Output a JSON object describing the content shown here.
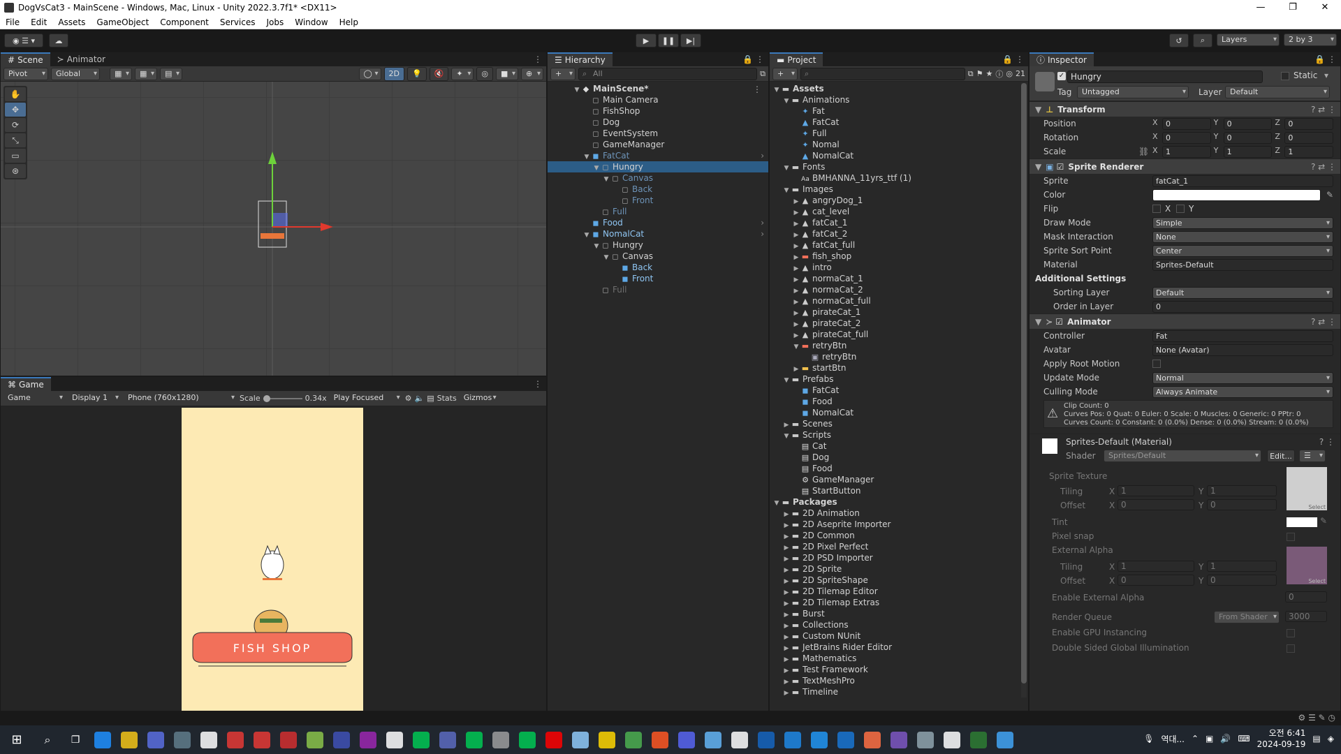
{
  "window": {
    "title": "DogVsCat3 - MainScene - Windows, Mac, Linux - Unity 2022.3.7f1* <DX11>",
    "minimize": "—",
    "maximize": "❐",
    "close": "✕"
  },
  "menu": [
    "File",
    "Edit",
    "Assets",
    "GameObject",
    "Component",
    "Services",
    "Jobs",
    "Window",
    "Help"
  ],
  "toolbar": {
    "layers_label": "Layers",
    "layout_label": "2 by 3"
  },
  "scene": {
    "tabs": [
      "Scene",
      "Animator"
    ],
    "pivot": "Pivot",
    "global": "Global",
    "mode_2d": "2D"
  },
  "game": {
    "tab": "Game",
    "mode": "Game",
    "display": "Display 1",
    "resolution": "Phone (760x1280)",
    "scale_label": "Scale",
    "scale_value": "0.34x",
    "play_focused": "Play Focused",
    "stats": "Stats",
    "gizmos": "Gizmos",
    "sign_text": "FISH  SHOP"
  },
  "hierarchy": {
    "tab": "Hierarchy",
    "search_placeholder": "All",
    "items": [
      {
        "label": "MainScene*",
        "depth": 0,
        "style": "scene"
      },
      {
        "label": "Main Camera",
        "depth": 1,
        "style": ""
      },
      {
        "label": "FishShop",
        "depth": 1,
        "style": ""
      },
      {
        "label": "Dog",
        "depth": 1,
        "style": ""
      },
      {
        "label": "EventSystem",
        "depth": 1,
        "style": ""
      },
      {
        "label": "GameManager",
        "depth": 1,
        "style": ""
      },
      {
        "label": "FatCat",
        "depth": 1,
        "style": "dim-prefab"
      },
      {
        "label": "Hungry",
        "depth": 2,
        "style": "selected"
      },
      {
        "label": "Canvas",
        "depth": 3,
        "style": "dim"
      },
      {
        "label": "Back",
        "depth": 4,
        "style": "dim"
      },
      {
        "label": "Front",
        "depth": 4,
        "style": "dim"
      },
      {
        "label": "Full",
        "depth": 2,
        "style": "dim"
      },
      {
        "label": "Food",
        "depth": 1,
        "style": "prefab"
      },
      {
        "label": "NomalCat",
        "depth": 1,
        "style": "prefab"
      },
      {
        "label": "Hungry",
        "depth": 2,
        "style": ""
      },
      {
        "label": "Canvas",
        "depth": 3,
        "style": ""
      },
      {
        "label": "Back",
        "depth": 4,
        "style": "prefab"
      },
      {
        "label": "Front",
        "depth": 4,
        "style": "prefab"
      },
      {
        "label": "Full",
        "depth": 2,
        "style": "dim2"
      }
    ]
  },
  "project": {
    "tab": "Project",
    "hidden_count": "21",
    "items": [
      {
        "label": "Assets",
        "depth": 0,
        "kind": "folder-open"
      },
      {
        "label": "Animations",
        "depth": 1,
        "kind": "folder-open"
      },
      {
        "label": "Fat",
        "depth": 2,
        "kind": "anim"
      },
      {
        "label": "FatCat",
        "depth": 2,
        "kind": "controller"
      },
      {
        "label": "Full",
        "depth": 2,
        "kind": "anim"
      },
      {
        "label": "Nomal",
        "depth": 2,
        "kind": "anim"
      },
      {
        "label": "NomalCat",
        "depth": 2,
        "kind": "controller"
      },
      {
        "label": "Fonts",
        "depth": 1,
        "kind": "folder-open"
      },
      {
        "label": "BMHANNA_11yrs_ttf (1)",
        "depth": 2,
        "kind": "font"
      },
      {
        "label": "Images",
        "depth": 1,
        "kind": "folder-open"
      },
      {
        "label": "angryDog_1",
        "depth": 2,
        "kind": "sprite"
      },
      {
        "label": "cat_level",
        "depth": 2,
        "kind": "sprite"
      },
      {
        "label": "fatCat_1",
        "depth": 2,
        "kind": "sprite"
      },
      {
        "label": "fatCat_2",
        "depth": 2,
        "kind": "sprite"
      },
      {
        "label": "fatCat_full",
        "depth": 2,
        "kind": "sprite"
      },
      {
        "label": "fish_shop",
        "depth": 2,
        "kind": "sprite-red"
      },
      {
        "label": "intro",
        "depth": 2,
        "kind": "sprite"
      },
      {
        "label": "normaCat_1",
        "depth": 2,
        "kind": "sprite"
      },
      {
        "label": "normaCat_2",
        "depth": 2,
        "kind": "sprite"
      },
      {
        "label": "normaCat_full",
        "depth": 2,
        "kind": "sprite"
      },
      {
        "label": "pirateCat_1",
        "depth": 2,
        "kind": "sprite"
      },
      {
        "label": "pirateCat_2",
        "depth": 2,
        "kind": "sprite"
      },
      {
        "label": "pirateCat_full",
        "depth": 2,
        "kind": "sprite"
      },
      {
        "label": "retryBtn",
        "depth": 2,
        "kind": "sprite-red-open"
      },
      {
        "label": "retryBtn",
        "depth": 3,
        "kind": "subsprite"
      },
      {
        "label": "startBtn",
        "depth": 2,
        "kind": "sprite-yellow"
      },
      {
        "label": "Prefabs",
        "depth": 1,
        "kind": "folder-open"
      },
      {
        "label": "FatCat",
        "depth": 2,
        "kind": "prefab"
      },
      {
        "label": "Food",
        "depth": 2,
        "kind": "prefab"
      },
      {
        "label": "NomalCat",
        "depth": 2,
        "kind": "prefab"
      },
      {
        "label": "Scenes",
        "depth": 1,
        "kind": "folder"
      },
      {
        "label": "Scripts",
        "depth": 1,
        "kind": "folder-open"
      },
      {
        "label": "Cat",
        "depth": 2,
        "kind": "script"
      },
      {
        "label": "Dog",
        "depth": 2,
        "kind": "script"
      },
      {
        "label": "Food",
        "depth": 2,
        "kind": "script"
      },
      {
        "label": "GameManager",
        "depth": 2,
        "kind": "gear"
      },
      {
        "label": "StartButton",
        "depth": 2,
        "kind": "script"
      },
      {
        "label": "Packages",
        "depth": 0,
        "kind": "folder-open"
      },
      {
        "label": "2D Animation",
        "depth": 1,
        "kind": "folder"
      },
      {
        "label": "2D Aseprite Importer",
        "depth": 1,
        "kind": "folder"
      },
      {
        "label": "2D Common",
        "depth": 1,
        "kind": "folder"
      },
      {
        "label": "2D Pixel Perfect",
        "depth": 1,
        "kind": "folder"
      },
      {
        "label": "2D PSD Importer",
        "depth": 1,
        "kind": "folder"
      },
      {
        "label": "2D Sprite",
        "depth": 1,
        "kind": "folder"
      },
      {
        "label": "2D SpriteShape",
        "depth": 1,
        "kind": "folder"
      },
      {
        "label": "2D Tilemap Editor",
        "depth": 1,
        "kind": "folder"
      },
      {
        "label": "2D Tilemap Extras",
        "depth": 1,
        "kind": "folder"
      },
      {
        "label": "Burst",
        "depth": 1,
        "kind": "folder"
      },
      {
        "label": "Collections",
        "depth": 1,
        "kind": "folder"
      },
      {
        "label": "Custom NUnit",
        "depth": 1,
        "kind": "folder"
      },
      {
        "label": "JetBrains Rider Editor",
        "depth": 1,
        "kind": "folder"
      },
      {
        "label": "Mathematics",
        "depth": 1,
        "kind": "folder"
      },
      {
        "label": "Test Framework",
        "depth": 1,
        "kind": "folder"
      },
      {
        "label": "TextMeshPro",
        "depth": 1,
        "kind": "folder"
      },
      {
        "label": "Timeline",
        "depth": 1,
        "kind": "folder"
      }
    ]
  },
  "inspector": {
    "tab": "Inspector",
    "object_name": "Hungry",
    "static_label": "Static",
    "tag_label": "Tag",
    "tag_value": "Untagged",
    "layer_label": "Layer",
    "layer_value": "Default",
    "transform": {
      "title": "Transform",
      "position_label": "Position",
      "rotation_label": "Rotation",
      "scale_label": "Scale",
      "position": [
        "0",
        "0",
        "0"
      ],
      "rotation": [
        "0",
        "0",
        "0"
      ],
      "scale": [
        "1",
        "1",
        "1"
      ]
    },
    "sprite_renderer": {
      "title": "Sprite Renderer",
      "sprite_label": "Sprite",
      "sprite": "fatCat_1",
      "color_label": "Color",
      "flip_label": "Flip",
      "flip_x": "X",
      "flip_y": "Y",
      "draw_mode_label": "Draw Mode",
      "draw_mode": "Simple",
      "mask_label": "Mask Interaction",
      "mask": "None",
      "sort_point_label": "Sprite Sort Point",
      "sort_point": "Center",
      "material_label": "Material",
      "material": "Sprites-Default",
      "additional_label": "Additional Settings",
      "sorting_layer_label": "Sorting Layer",
      "sorting_layer": "Default",
      "order_label": "Order in Layer",
      "order": "0"
    },
    "animator": {
      "title": "Animator",
      "controller_label": "Controller",
      "controller": "Fat",
      "avatar_label": "Avatar",
      "avatar": "None (Avatar)",
      "root_motion_label": "Apply Root Motion",
      "update_label": "Update Mode",
      "update": "Normal",
      "culling_label": "Culling Mode",
      "culling": "Always Animate",
      "info_line1": "Clip Count: 0",
      "info_line2": "Curves Pos: 0 Quat: 0 Euler: 0 Scale: 0 Muscles: 0 Generic: 0 PPtr: 0",
      "info_line3": "Curves Count: 0 Constant: 0 (0.0%) Dense: 0 (0.0%) Stream: 0 (0.0%)"
    },
    "material": {
      "title": "Sprites-Default (Material)",
      "shader_label": "Shader",
      "shader": "Sprites/Default",
      "edit_label": "Edit...",
      "sprite_texture_label": "Sprite Texture",
      "tiling_label": "Tiling",
      "offset_label": "Offset",
      "tiling": [
        "1",
        "1"
      ],
      "offset": [
        "0",
        "0"
      ],
      "tint_label": "Tint",
      "pixel_snap_label": "Pixel snap",
      "external_alpha_label": "External Alpha",
      "tiling2": [
        "1",
        "1"
      ],
      "offset2": [
        "0",
        "0"
      ],
      "enable_ext_alpha_label": "Enable External Alpha",
      "enable_ext_alpha": "0",
      "render_queue_label": "Render Queue",
      "render_queue_mode": "From Shader",
      "render_queue": "3000",
      "gpu_instancing_label": "Enable GPU Instancing",
      "double_sided_label": "Double Sided Global Illumination",
      "select_label": "Select"
    }
  },
  "taskbar": {
    "lang": "역대...",
    "time": "오전 6:41",
    "date": "2024-09-19",
    "colors": [
      "#1e90ff",
      "#f5c518",
      "#5b6ee1",
      "#607d8b",
      "#ffffff",
      "#e53935",
      "#e53935",
      "#d32f2f",
      "#8bc34a",
      "#3f51b5",
      "#9c27b0",
      "#ffffff",
      "#00c853",
      "#5c6bc0",
      "#00c853",
      "#9e9e9e",
      "#00c853",
      "#ff0000",
      "#90caf9",
      "#ffd600",
      "#4caf50",
      "#ff5722",
      "#5865f2",
      "#64b5f6",
      "#ffffff",
      "#1565c0",
      "#1e88e5",
      "#2196f3",
      "#1976d2",
      "#ff7043",
      "#7e57c2",
      "#90a4ae",
      "#ffffff",
      "#2e7d32",
      "#42a5f5"
    ]
  }
}
